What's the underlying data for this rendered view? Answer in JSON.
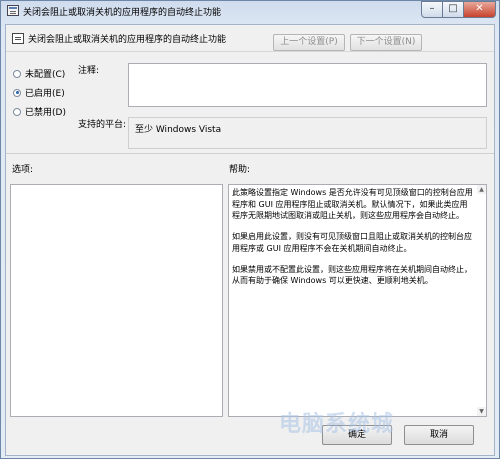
{
  "window": {
    "title": "关闭会阻止或取消关机的应用程序的自动终止功能",
    "controls": {
      "minimize": "–",
      "maximize": "□",
      "close": "✕"
    }
  },
  "header": {
    "policy_title": "关闭会阻止或取消关机的应用程序的自动终止功能",
    "prev_label": "上一个设置(P)",
    "next_label": "下一个设置(N)"
  },
  "state_options": [
    {
      "label": "未配置(C)",
      "checked": false
    },
    {
      "label": "已启用(E)",
      "checked": true
    },
    {
      "label": "已禁用(D)",
      "checked": false
    }
  ],
  "comment": {
    "label": "注释:",
    "value": ""
  },
  "platform": {
    "label": "支持的平台:",
    "value": "至少 Windows Vista"
  },
  "options_label": "选项:",
  "help_label": "帮助:",
  "help_paragraphs": [
    "此策略设置指定 Windows 是否允许没有可见顶级窗口的控制台应用程序和 GUI 应用程序阻止或取消关机。默认情况下，如果此类应用程序无限期地试图取消或阻止关机，则这些应用程序会自动终止。",
    "如果启用此设置，则没有可见顶级窗口且阻止或取消关机的控制台应用程序或 GUI 应用程序不会在关机期间自动终止。",
    "如果禁用或不配置此设置，则这些应用程序将在关机期间自动终止，从而有助于确保 Windows 可以更快速、更顺利地关机。"
  ],
  "footer": {
    "ok_label": "确定",
    "cancel_label": "取消"
  },
  "watermark": {
    "text": "电脑系统城"
  }
}
